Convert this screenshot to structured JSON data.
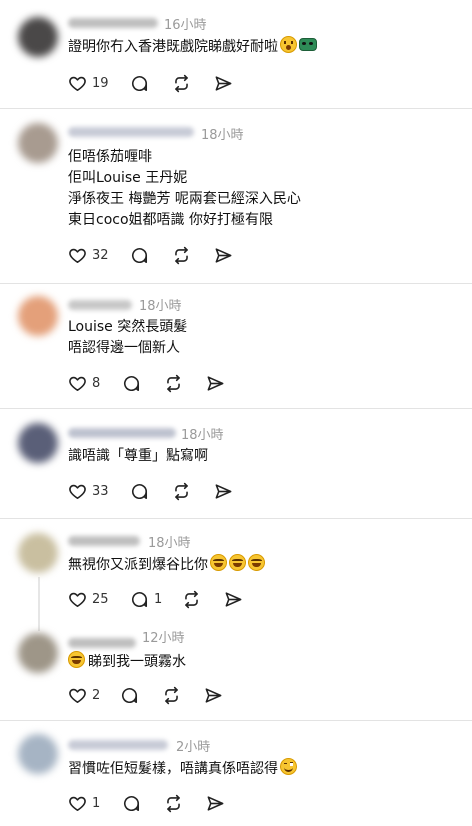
{
  "colors": {
    "text": "#101010",
    "muted": "#9a9a9a",
    "divider": "#e3e3e3",
    "icon": "#222222"
  },
  "posts": [
    {
      "time": "16小時",
      "lines": [
        "證明你冇入香港既戲院睇戲好耐啦"
      ],
      "emoji": [
        "wow-face",
        "mask"
      ],
      "likes": "19",
      "replies": "",
      "avatar_color": "#4a4848",
      "name_color": "#8a8a8a"
    },
    {
      "time": "18小時",
      "lines": [
        "佢唔係茄喱啡",
        "佢叫Louise 王丹妮",
        "淨係夜王 梅艷芳 呢兩套已經深入民心",
        "東日coco姐都唔識 你好打極有限"
      ],
      "emoji": [],
      "likes": "32",
      "replies": "",
      "avatar_color": "#a89b90",
      "name_color": "#9aa0b5"
    },
    {
      "time": "18小時",
      "lines": [
        "Louise 突然長頭髮",
        "唔認得邊一個新人"
      ],
      "emoji": [],
      "likes": "8",
      "replies": "",
      "avatar_color": "#e4a07a",
      "name_color": "#9a9a9a"
    },
    {
      "time": "18小時",
      "lines": [
        "識唔識「尊重」點寫啊"
      ],
      "emoji": [],
      "likes": "33",
      "replies": "",
      "avatar_color": "#5a5f78",
      "name_color": "#8890a8"
    },
    {
      "time": "18小時",
      "lines": [
        "無視你又派到爆谷比你"
      ],
      "emoji": [
        "laugh",
        "laugh",
        "laugh"
      ],
      "likes": "25",
      "replies": "1",
      "avatar_color": "#c9bfa0",
      "name_color": "#8a8a8a"
    },
    {
      "time": "12小時",
      "lines": [
        "睇到我一頭霧水"
      ],
      "emoji_prefix": [
        "laugh"
      ],
      "emoji": [],
      "likes": "2",
      "replies": "",
      "avatar_color": "#9e9688",
      "name_color": "#8a8a8a"
    },
    {
      "time": "2小時",
      "lines": [
        "習慣咗佢短髮樣，唔講真係唔認得"
      ],
      "emoji": [
        "blush"
      ],
      "likes": "1",
      "replies": "",
      "avatar_color": "#a6b4c4",
      "name_color": "#9aa0b5"
    }
  ]
}
